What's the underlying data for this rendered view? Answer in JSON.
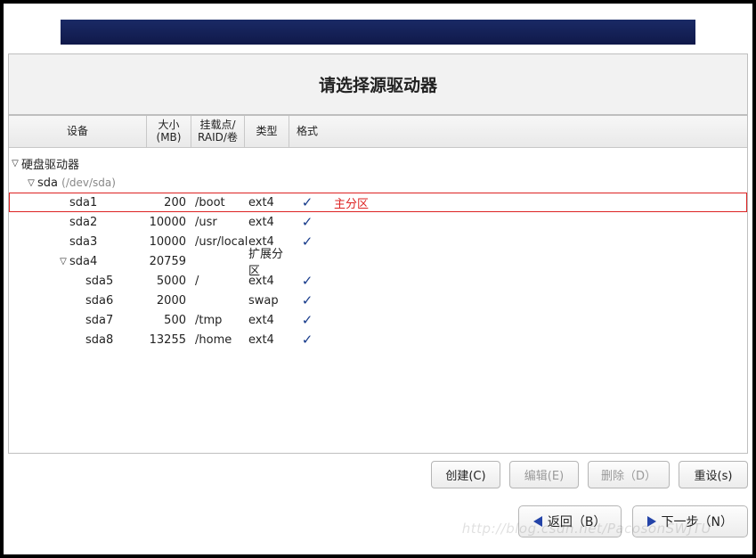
{
  "title": "请选择源驱动器",
  "columns": {
    "device": "设备",
    "size": "大小\n(MB)",
    "mount": "挂载点/\nRAID/卷",
    "type": "类型",
    "format": "格式"
  },
  "tree": {
    "root_label": "硬盘驱动器",
    "disk_label": "sda",
    "disk_path": "(/dev/sda)",
    "partitions": [
      {
        "name": "sda1",
        "size": "200",
        "mount": "/boot",
        "type": "ext4",
        "fmt": true,
        "indent": 2,
        "highlight": true,
        "annotation": "主分区"
      },
      {
        "name": "sda2",
        "size": "10000",
        "mount": "/usr",
        "type": "ext4",
        "fmt": true,
        "indent": 2
      },
      {
        "name": "sda3",
        "size": "10000",
        "mount": "/usr/local",
        "type": "ext4",
        "fmt": true,
        "indent": 2
      },
      {
        "name": "sda4",
        "size": "20759",
        "mount": "",
        "type": "扩展分区",
        "fmt": false,
        "indent": 2,
        "expander": true
      },
      {
        "name": "sda5",
        "size": "5000",
        "mount": "/",
        "type": "ext4",
        "fmt": true,
        "indent": 3
      },
      {
        "name": "sda6",
        "size": "2000",
        "mount": "",
        "type": "swap",
        "fmt": true,
        "indent": 3
      },
      {
        "name": "sda7",
        "size": "500",
        "mount": "/tmp",
        "type": "ext4",
        "fmt": true,
        "indent": 3
      },
      {
        "name": "sda8",
        "size": "13255",
        "mount": "/home",
        "type": "ext4",
        "fmt": true,
        "indent": 3
      }
    ]
  },
  "buttons": {
    "create": "创建(C)",
    "edit": "编辑(E)",
    "delete": "删除（D）",
    "reset": "重设(s)"
  },
  "nav": {
    "back": "返回（B）",
    "next": "下一步（N）"
  },
  "watermark": "http://blog.csdn.net/PacosonSWJTU"
}
